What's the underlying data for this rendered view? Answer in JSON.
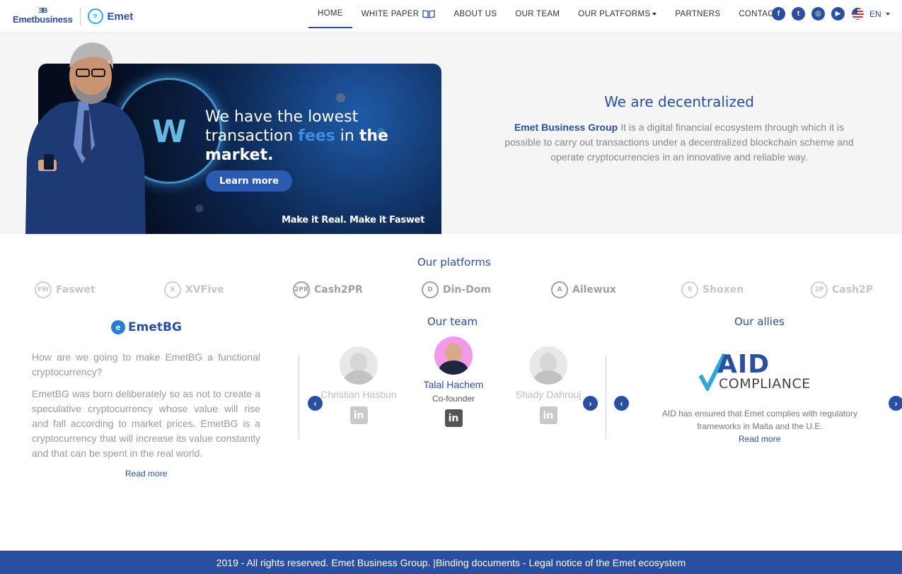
{
  "brand": {
    "primary_logo_text": "Emetbusiness",
    "secondary_logo_text": "Emet"
  },
  "nav": {
    "items": [
      {
        "label": "HOME",
        "active": true
      },
      {
        "label": "WHITE PAPER",
        "icon": "book-icon"
      },
      {
        "label": "ABOUT US"
      },
      {
        "label": "OUR TEAM"
      },
      {
        "label": "OUR PLATFORMS",
        "icon": "caret-down-icon"
      },
      {
        "label": "PARTNERS"
      },
      {
        "label": "CONTACT"
      }
    ],
    "socials": [
      "facebook-icon",
      "twitter-icon",
      "instagram-icon",
      "youtube-icon"
    ],
    "language": "EN"
  },
  "hero": {
    "headline_part1": "We have the lowest",
    "headline_part2": "transaction",
    "headline_fees": "fees",
    "headline_in": "in",
    "headline_the": "the",
    "headline_market": "market.",
    "cta": "Learn more",
    "tagline": "Make it Real. Make it Faswet",
    "side_title": "We are decentralized",
    "side_brand": "Emet Business Group",
    "side_text": " It is a digital financial ecosystem through which it is possible to carry out transactions under a decentralized blockchain scheme and operate cryptocurrencies in an innovative and reliable way."
  },
  "platforms": {
    "title": "Our platforms",
    "items": [
      {
        "name": "Faswet",
        "badge": "FW"
      },
      {
        "name": "XVFive",
        "badge": "X"
      },
      {
        "name": "Cash2PR",
        "badge": "2PR"
      },
      {
        "name": "Din-Dom",
        "badge": "D"
      },
      {
        "name": "Ailewux",
        "badge": "A"
      },
      {
        "name": "Shoxen",
        "badge": "S"
      },
      {
        "name": "Cash2P",
        "badge": "2P"
      }
    ]
  },
  "emetbg": {
    "logo_text": "EmetBG",
    "paragraph1": "How are we going to make EmetBG a functional cryptocurrency?",
    "paragraph2": "EmetBG was born deliberately so as not to create a speculative cryptocurrency whose value will rise and fall according to market prices. EmetBG is a cryptocurrency that will increase its value constantly and that can be spent in the real world.",
    "read_more": "Read more"
  },
  "team": {
    "title": "Our team",
    "members": [
      {
        "name": "Christian Hasbun",
        "role": ""
      },
      {
        "name": "Talal Hachem",
        "role": "Co-founder"
      },
      {
        "name": "Shady Dahrouj",
        "role": ""
      }
    ],
    "linkedin_glyph": "in"
  },
  "allies": {
    "title": "Our allies",
    "logo_main": "AID",
    "logo_sub": "COMPLIANCE",
    "description": "AID has ensured that Emet complies with regulatory frameworks in Malta and the U.E.",
    "read_more": "Read more"
  },
  "footer": {
    "copyright": "2019 - All rights reserved. Emet Business Group. | ",
    "link": "Binding documents - Legal notice of the Emet ecosystem"
  },
  "colors": {
    "brand_blue": "#2a4fa1",
    "hero_bg": "#f5f5f6",
    "footer_bg": "#2a4fa1"
  }
}
